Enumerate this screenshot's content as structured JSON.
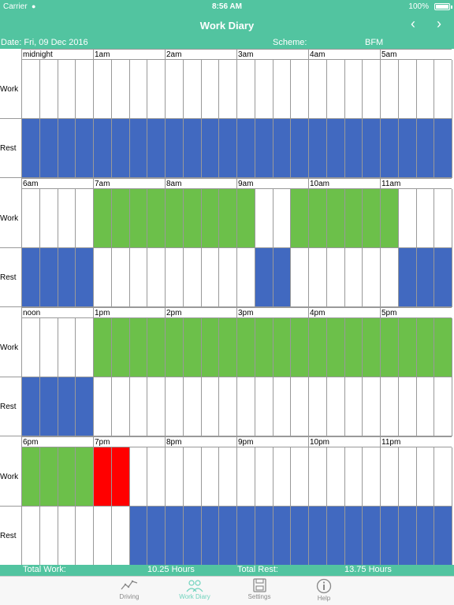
{
  "status": {
    "carrier": "Carrier",
    "time": "8:56 AM",
    "battery": "100%"
  },
  "nav": {
    "title": "Work Diary",
    "prev": "‹",
    "next": "›"
  },
  "info": {
    "date": "Date: Fri, 09 Dec 2016",
    "scheme_label": "Scheme:",
    "scheme_value": "BFM"
  },
  "diary": {
    "row_labels": {
      "work": "Work",
      "rest": "Rest"
    },
    "colors": {
      "work": "#6cc04a",
      "rest": "#4169c0",
      "empty": "#ffffff",
      "violation": "#ff0000"
    },
    "hours": [
      "midnight",
      "1am",
      "2am",
      "3am",
      "4am",
      "5am",
      "6am",
      "7am",
      "8am",
      "9am",
      "10am",
      "11am",
      "noon",
      "1pm",
      "2pm",
      "3pm",
      "4pm",
      "5pm",
      "6pm",
      "7pm",
      "8pm",
      "9pm",
      "10pm",
      "11pm"
    ],
    "work": [
      "000000000000000000000000",
      "0000WWWWWWWWW00WWWWWW000",
      "0000WWWWWWWWWWWWWWWWWWWW",
      "WWWWRR000000000000000000"
    ],
    "rest": [
      "RRRRRRRRRRRRRRRRRRRRRRRR",
      "RRRR000000000RR000000RRR",
      "RRRR00000000000000000000",
      "000000RRRRRRRRRRRRRRRRRR"
    ]
  },
  "totals": {
    "work_label": "Total Work:",
    "work_value": "10.25 Hours",
    "rest_label": "Total Rest:",
    "rest_value": "13.75 Hours"
  },
  "tabs": [
    {
      "label": "Driving",
      "icon": "driving-chart-icon",
      "active": false
    },
    {
      "label": "Work Diary",
      "icon": "work-diary-people-icon",
      "active": true
    },
    {
      "label": "Settings",
      "icon": "settings-floppy-icon",
      "active": false
    },
    {
      "label": "Help",
      "icon": "help-info-icon",
      "active": false
    }
  ]
}
